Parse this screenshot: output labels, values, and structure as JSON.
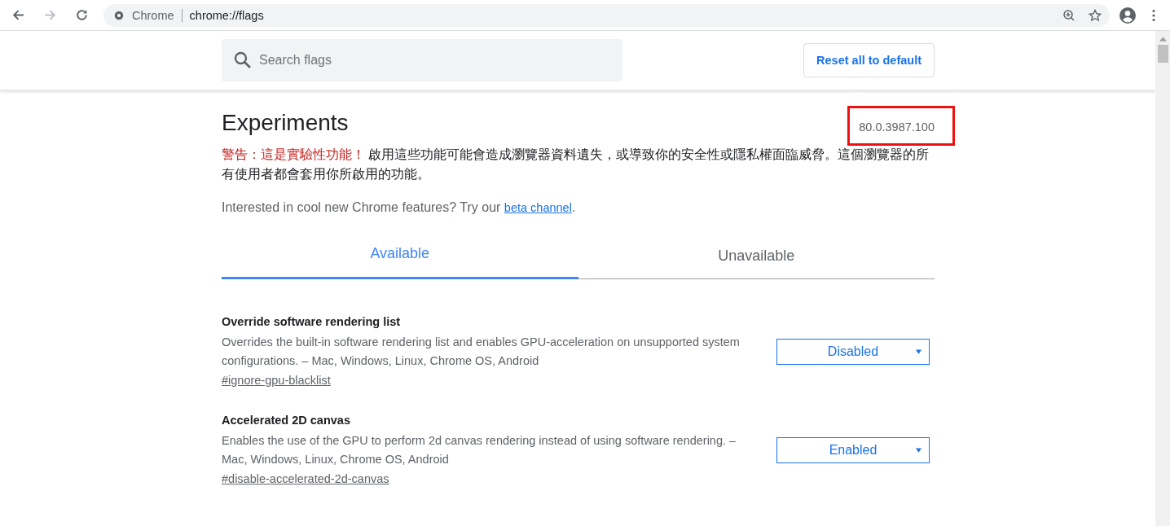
{
  "browser": {
    "site_label": "Chrome",
    "url": "chrome://flags"
  },
  "search": {
    "placeholder": "Search flags"
  },
  "reset_button": "Reset all to default",
  "title": "Experiments",
  "version": "80.0.3987.100",
  "warning": {
    "alert": "警告：這是實驗性功能！",
    "body": " 啟用這些功能可能會造成瀏覽器資料遺失，或導致你的安全性或隱私權面臨威脅。這個瀏覽器的所有使用者都會套用你所啟用的功能。"
  },
  "intro": {
    "before": "Interested in cool new Chrome features? Try our ",
    "link": "beta channel",
    "after": "."
  },
  "tabs": [
    {
      "label": "Available",
      "selected": true
    },
    {
      "label": "Unavailable",
      "selected": false
    }
  ],
  "flags": [
    {
      "name": "Override software rendering list",
      "description": "Overrides the built-in software rendering list and enables GPU-acceleration on unsupported system configurations. – Mac, Windows, Linux, Chrome OS, Android",
      "link": "#ignore-gpu-blacklist",
      "value": "Disabled"
    },
    {
      "name": "Accelerated 2D canvas",
      "description": "Enables the use of the GPU to perform 2d canvas rendering instead of using software rendering. – Mac, Windows, Linux, Chrome OS, Android",
      "link": "#disable-accelerated-2d-canvas",
      "value": "Enabled"
    }
  ]
}
